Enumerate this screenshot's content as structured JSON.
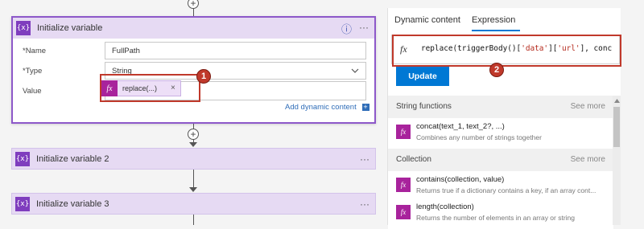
{
  "flow": {
    "active_card": {
      "title": "Initialize variable",
      "icon": "{x}",
      "info_icon": "ⓘ",
      "more": "···",
      "fields": {
        "name_label": "*Name",
        "name_value": "FullPath",
        "type_label": "*Type",
        "type_value": "String",
        "value_label": "Value"
      },
      "token": {
        "fx": "fx",
        "label": "replace(...)",
        "remove": "×"
      },
      "add_dynamic": "Add dynamic content",
      "add_dynamic_icon": "+"
    },
    "collapsed_cards": [
      {
        "title": "Initialize variable 2",
        "icon": "{x}",
        "more": "···"
      },
      {
        "title": "Initialize variable 3",
        "icon": "{x}",
        "more": "···"
      }
    ],
    "plus": "+"
  },
  "annotations": {
    "badge1": "1",
    "badge2": "2"
  },
  "panel": {
    "tabs": [
      "Dynamic content",
      "Expression"
    ],
    "active_tab": 1,
    "fx": "fx",
    "expression_parts": [
      {
        "text": "replace(triggerBody()[",
        "kind": "plain"
      },
      {
        "text": "'data'",
        "kind": "string"
      },
      {
        "text": "][",
        "kind": "plain"
      },
      {
        "text": "'url'",
        "kind": "string"
      },
      {
        "text": "], conc",
        "kind": "plain"
      }
    ],
    "update_button": "Update",
    "sections": [
      {
        "title": "String functions",
        "see_more": "See more",
        "items": [
          {
            "name": "concat(text_1, text_2?, ...)",
            "desc": "Combines any number of strings together"
          }
        ]
      },
      {
        "title": "Collection",
        "see_more": "See more",
        "items": [
          {
            "name": "contains(collection, value)",
            "desc": "Returns true if a dictionary contains a key, if an array cont..."
          },
          {
            "name": "length(collection)",
            "desc": "Returns the number of elements in an array or string"
          }
        ]
      }
    ],
    "fn_icon": "fx"
  },
  "colors": {
    "accent": "#8d58c9",
    "button": "#0078d4",
    "annotation": "#c0392b",
    "function": "#a8239c"
  }
}
